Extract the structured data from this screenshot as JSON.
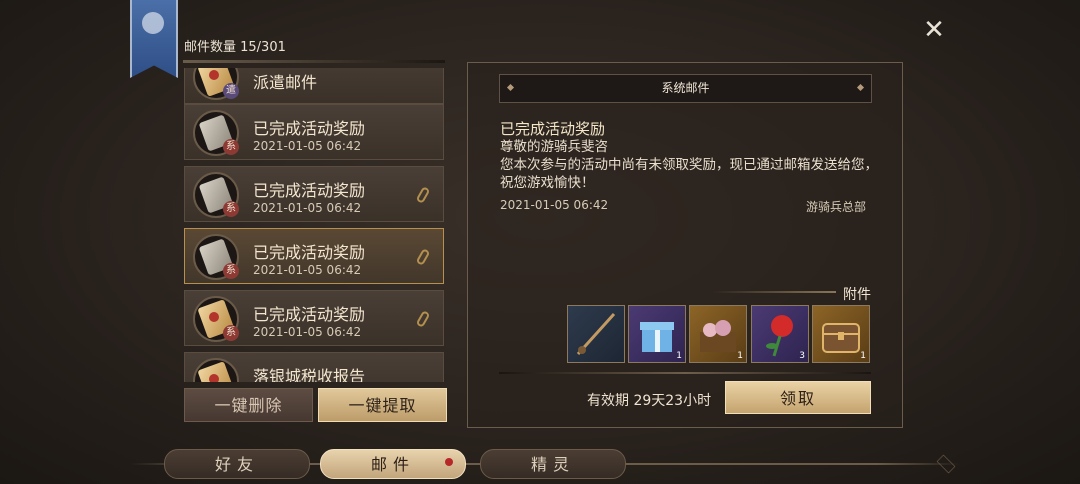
{
  "header": {
    "mail_count_label": "邮件数量 15/301"
  },
  "mail_list": {
    "items": [
      {
        "title": "派遣邮件",
        "date": "",
        "badge": "遣",
        "icon": "scroll-gold-icon",
        "attachment": false,
        "selected": false
      },
      {
        "title": "已完成活动奖励",
        "date": "2021-01-05 06:42",
        "badge": "系",
        "icon": "scroll-paper-icon",
        "attachment": false,
        "selected": false
      },
      {
        "title": "已完成活动奖励",
        "date": "2021-01-05 06:42",
        "badge": "系",
        "icon": "scroll-paper-icon",
        "attachment": true,
        "selected": false
      },
      {
        "title": "已完成活动奖励",
        "date": "2021-01-05 06:42",
        "badge": "系",
        "icon": "scroll-paper-icon",
        "attachment": true,
        "selected": true
      },
      {
        "title": "已完成活动奖励",
        "date": "2021-01-05 06:42",
        "badge": "系",
        "icon": "scroll-gold-icon",
        "attachment": true,
        "selected": false
      },
      {
        "title": "落银城税收报告",
        "date": "",
        "badge": "",
        "icon": "scroll-gold-icon",
        "attachment": false,
        "selected": false
      }
    ]
  },
  "buttons": {
    "delete_all": "一键删除",
    "claim_all": "一键提取",
    "claim": "领取"
  },
  "detail": {
    "header": "系统邮件",
    "title": "已完成活动奖励",
    "greeting": "尊敬的游骑兵斐咨",
    "body": "您本次参与的活动中尚有未领取奖励，现已通过邮箱发送给您，祝您游戏愉快！",
    "date": "2021-01-05 06:42",
    "sender": "游骑兵总部",
    "attachments_label": "附件",
    "attachments": [
      {
        "icon": "fishing-rod-icon",
        "count": ""
      },
      {
        "icon": "gift-box-icon",
        "count": "1"
      },
      {
        "icon": "treasure-pile-icon",
        "count": "1"
      },
      {
        "icon": "rose-icon",
        "count": "3"
      },
      {
        "icon": "treasure-chest-icon",
        "count": "1"
      }
    ],
    "validity": "有效期 29天23小时"
  },
  "tabs": [
    {
      "label": "好友",
      "active": false
    },
    {
      "label": "邮件",
      "active": true
    },
    {
      "label": "精灵",
      "active": false
    }
  ],
  "colors": {
    "accent_gold": "#d9bf8c",
    "badge_red": "#8d3a34",
    "banner_blue": "#3a5a94"
  }
}
